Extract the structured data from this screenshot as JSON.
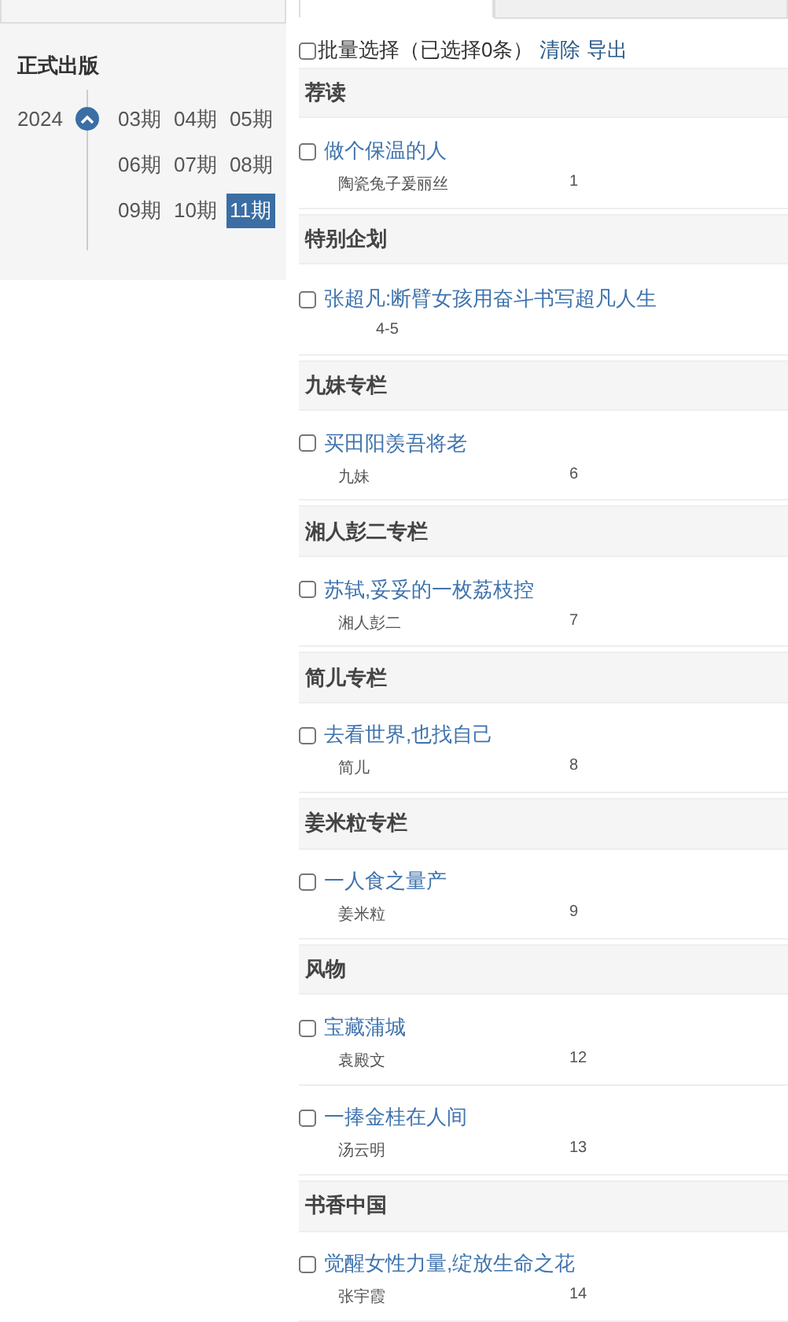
{
  "sidebar": {
    "heading": "正式出版",
    "years": [
      {
        "year": "2024",
        "expanded": true,
        "issues": [
          {
            "label": "03期",
            "selected": false
          },
          {
            "label": "04期",
            "selected": false
          },
          {
            "label": "05期",
            "selected": false
          },
          {
            "label": "06期",
            "selected": false
          },
          {
            "label": "07期",
            "selected": false
          },
          {
            "label": "08期",
            "selected": false
          },
          {
            "label": "09期",
            "selected": false
          },
          {
            "label": "10期",
            "selected": false
          },
          {
            "label": "11期",
            "selected": true
          }
        ]
      }
    ]
  },
  "tabs": [
    {
      "selected": true
    },
    {
      "selected": false
    }
  ],
  "batch": {
    "checked": false,
    "label": "批量选择（已选择0条）",
    "links": [
      "清除",
      "导出"
    ]
  },
  "sections": [
    {
      "title": "荐读",
      "articles": [
        {
          "title": "做个保温的人",
          "author": "陶瓷兔子爰丽丝",
          "page": "1",
          "checked": false
        }
      ]
    },
    {
      "title": "特别企划",
      "articles": [
        {
          "title": "张超凡:断臂女孩用奋斗书写超凡人生",
          "page": "4-5",
          "checked": false
        }
      ]
    },
    {
      "title": "九妹专栏",
      "articles": [
        {
          "title": "买田阳羡吾将老",
          "author": "九妹",
          "page": "6",
          "checked": false
        }
      ]
    },
    {
      "title": "湘人彭二专栏",
      "articles": [
        {
          "title": "苏轼,妥妥的一枚荔枝控",
          "author": "湘人彭二",
          "page": "7",
          "checked": false
        }
      ]
    },
    {
      "title": "简儿专栏",
      "articles": [
        {
          "title": "去看世界,也找自己",
          "author": "简儿",
          "page": "8",
          "checked": false
        }
      ]
    },
    {
      "title": "姜米粒专栏",
      "articles": [
        {
          "title": "一人食之量产",
          "author": "姜米粒",
          "page": "9",
          "checked": false
        }
      ]
    },
    {
      "title": "风物",
      "articles": [
        {
          "title": "宝藏蒲城",
          "author": "袁殿文",
          "page": "12",
          "checked": false
        },
        {
          "title": "一捧金桂在人间",
          "author": "汤云明",
          "page": "13",
          "checked": false
        }
      ]
    },
    {
      "title": "书香中国",
      "articles": [
        {
          "title": "觉醒女性力量,绽放生命之花",
          "author": "张宇霞",
          "page": "14",
          "checked": false
        }
      ]
    }
  ]
}
